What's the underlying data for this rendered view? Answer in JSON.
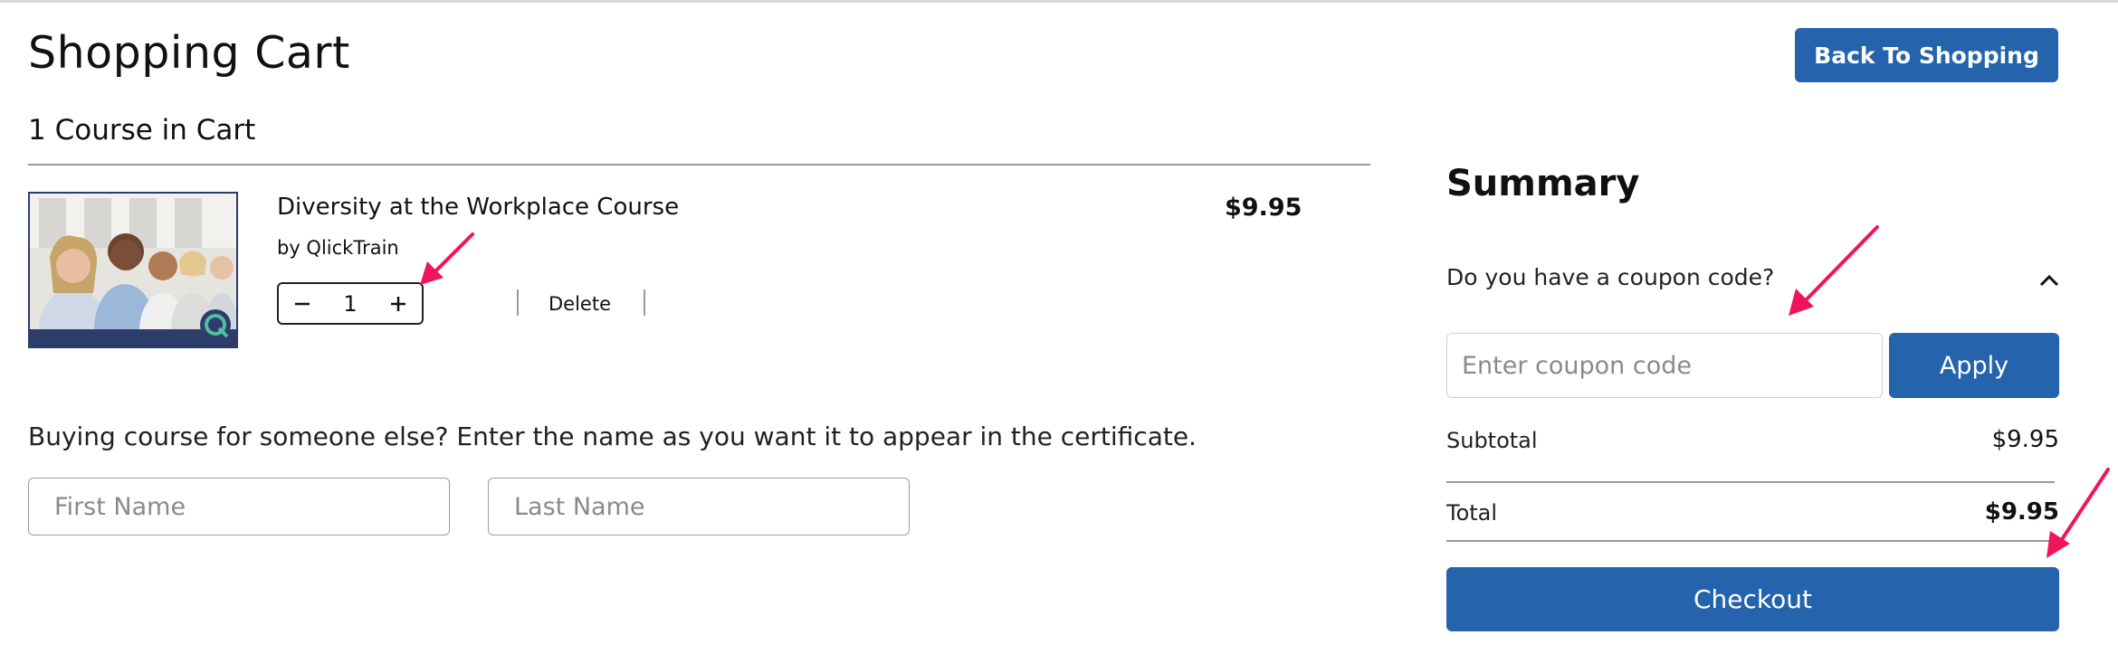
{
  "header": {
    "title": "Shopping Cart",
    "back_button": "Back To Shopping"
  },
  "cart": {
    "count_text": "1 Course in Cart",
    "items": [
      {
        "title": "Diversity at the Workplace Course",
        "author": "by QlickTrain",
        "price": "$9.95",
        "quantity": "1",
        "delete_label": "Delete"
      }
    ]
  },
  "gift": {
    "prompt": "Buying course for someone else? Enter the name as you want it to appear in the certificate.",
    "first_name_placeholder": "First Name",
    "last_name_placeholder": "Last Name"
  },
  "summary": {
    "title": "Summary",
    "coupon_question": "Do you have a coupon code?",
    "coupon_placeholder": "Enter coupon code",
    "apply_label": "Apply",
    "subtotal_label": "Subtotal",
    "subtotal_value": "$9.95",
    "total_label": "Total",
    "total_value": "$9.95",
    "checkout_label": "Checkout"
  },
  "icons": {
    "minus": "minus-icon",
    "plus": "plus-icon",
    "chevron": "chevron-up-icon",
    "annotation": "pink-arrow-icon"
  },
  "colors": {
    "primary": "#2563ad",
    "annotation": "#f0145a",
    "thumb_bg": "#2e3c6b"
  }
}
